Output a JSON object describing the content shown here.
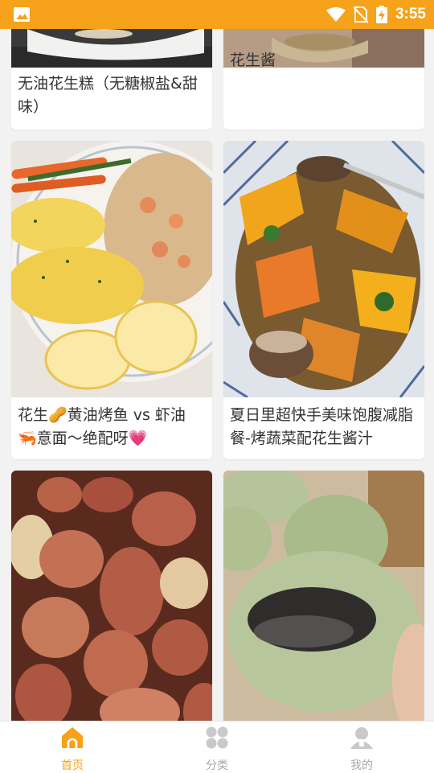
{
  "status_bar": {
    "time": "3:55",
    "icons": [
      "image-icon",
      "wifi-icon",
      "no-sim-icon",
      "battery-charging-icon"
    ]
  },
  "colors": {
    "accent": "#f7a21b",
    "inactive": "#a9a9a9",
    "text": "#333333"
  },
  "feed": {
    "cards": [
      {
        "title": "无油花生糕（无糖椒盐&甜味）",
        "image": "peanut-cake-photo"
      },
      {
        "title": "花生酱",
        "image": "peanut-butter-photo"
      },
      {
        "title": "花生🥜黄油烤鱼 vs 虾油🦐意面～绝配呀💗",
        "image": "baked-fish-and-pasta-photo"
      },
      {
        "title": "夏日里超快手美味饱腹减脂餐-烤蔬菜配花生酱汁",
        "image": "roasted-vegetables-photo"
      },
      {
        "title": "",
        "image": "raw-peanuts-photo"
      },
      {
        "title": "",
        "image": "green-steamed-buns-photo"
      }
    ]
  },
  "bottom_nav": {
    "items": [
      {
        "label": "首页",
        "icon": "home-icon",
        "active": true
      },
      {
        "label": "分类",
        "icon": "category-grid-icon",
        "active": false
      },
      {
        "label": "我的",
        "icon": "profile-icon",
        "active": false
      }
    ]
  }
}
